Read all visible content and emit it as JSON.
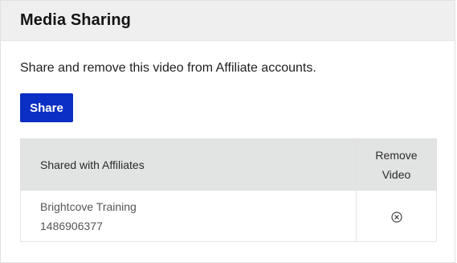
{
  "panel": {
    "title": "Media Sharing",
    "description": "Share and remove this video from Affiliate accounts.",
    "share_label": "Share"
  },
  "table": {
    "headers": {
      "name": "Shared with Affiliates",
      "remove_line1": "Remove",
      "remove_line2": "Video"
    },
    "rows": [
      {
        "name": "Brightcove Training",
        "id": "1486906377",
        "remove_icon": "circle-x-icon"
      }
    ]
  },
  "colors": {
    "accent": "#0b2fc4",
    "header_bg": "#efefef",
    "table_header_bg": "#e2e4e3"
  }
}
